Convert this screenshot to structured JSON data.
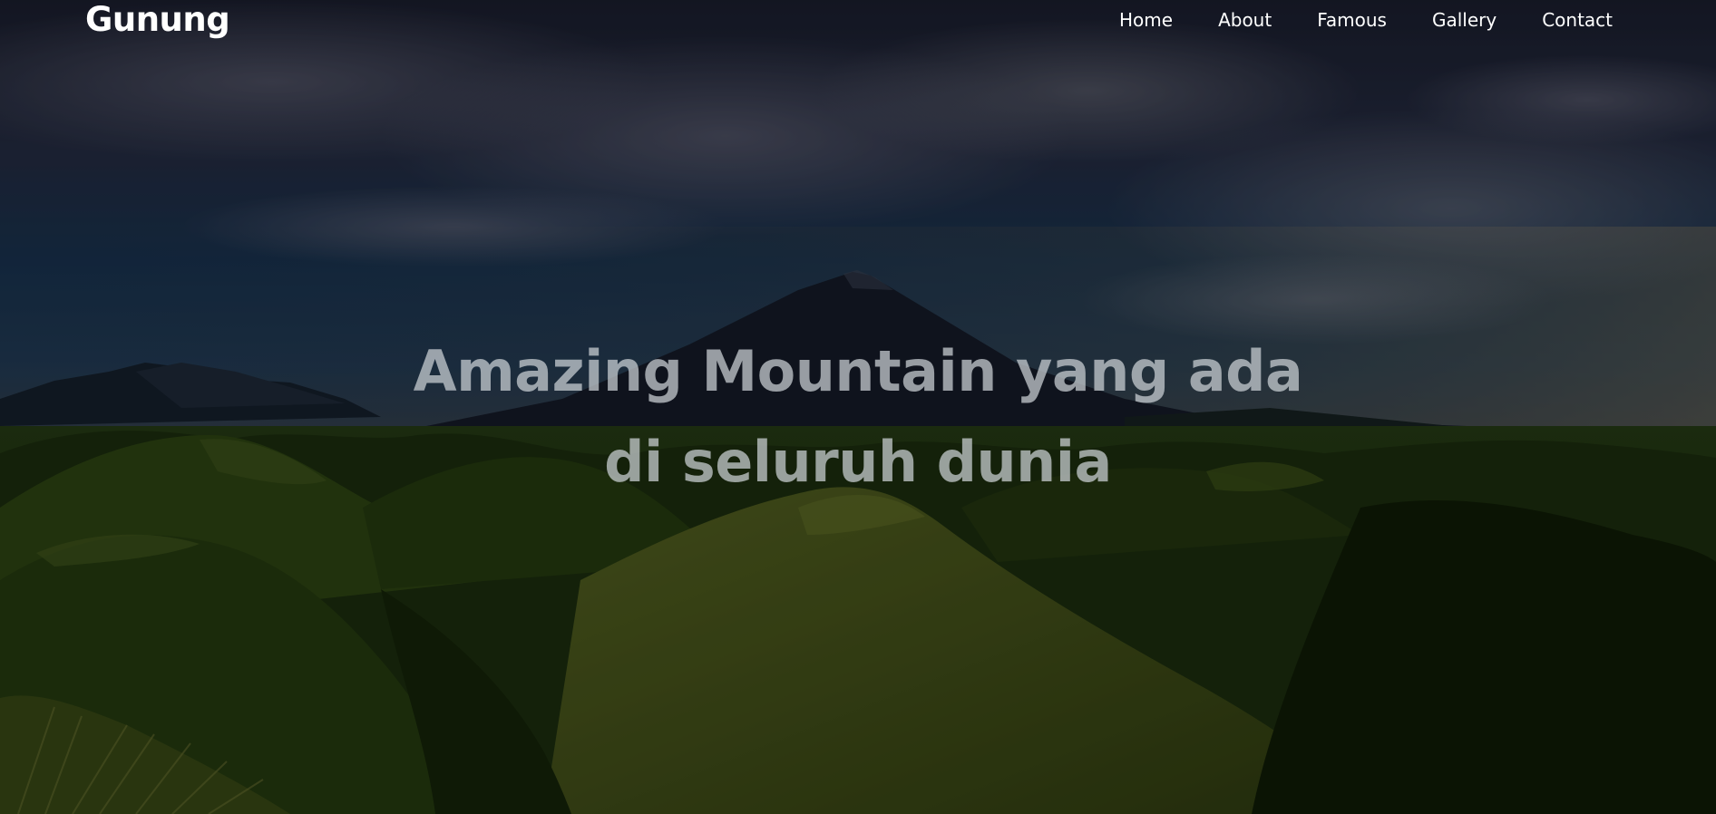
{
  "brand": {
    "name": "Gunung"
  },
  "nav": {
    "items": [
      {
        "label": "Home"
      },
      {
        "label": "About"
      },
      {
        "label": "Famous"
      },
      {
        "label": "Gallery"
      },
      {
        "label": "Contact"
      }
    ]
  },
  "hero": {
    "title_line1": "Amazing Mountain yang ada",
    "title_line2": "di seluruh dunia",
    "background": "mountain-landscape-image"
  },
  "colors": {
    "text": "#ffffff",
    "title": "#cdd2d7",
    "sky_top": "#1b2a48",
    "hills": "#3c5a16"
  }
}
